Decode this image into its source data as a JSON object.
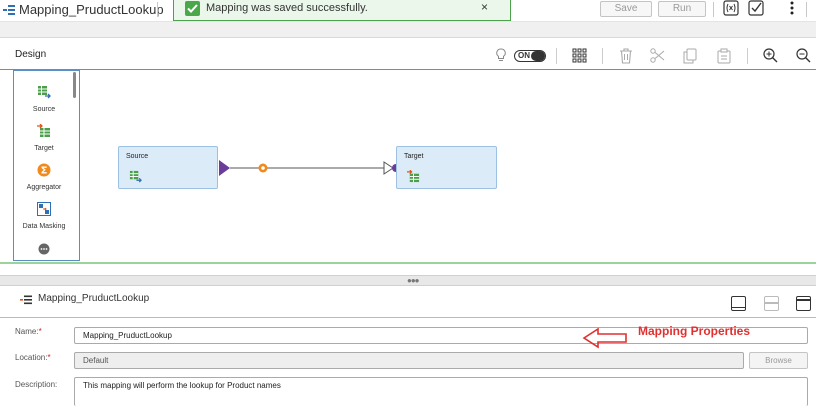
{
  "header": {
    "title": "Mapping_PruductLookup",
    "toast_message": "Mapping was saved successfully.",
    "toast_close": "×",
    "save_label": "Save",
    "run_label": "Run"
  },
  "design": {
    "label": "Design",
    "toggle_label": "ON"
  },
  "palette": {
    "items": [
      {
        "label": "Source"
      },
      {
        "label": "Target"
      },
      {
        "label": "Aggregator"
      },
      {
        "label": "Data Masking"
      }
    ]
  },
  "canvas": {
    "nodes": [
      {
        "label": "Source"
      },
      {
        "label": "Target"
      }
    ]
  },
  "properties": {
    "title": "Mapping_PruductLookup",
    "name_label": "Name:",
    "name_value": "Mapping_PruductLookup",
    "location_label": "Location:",
    "location_value": "Default",
    "browse_label": "Browse",
    "description_label": "Description:",
    "description_value": "This mapping will perform the lookup for Product names",
    "required_marker": "*"
  },
  "annotation": {
    "text": "Mapping Properties"
  },
  "colors": {
    "accent_blue": "#5b8fc4",
    "node_fill": "#dcebf8",
    "success_green": "#4aa84a",
    "annotation_red": "#e03030",
    "link_purple": "#6a3d9a",
    "expression_orange": "#f08a1c"
  }
}
